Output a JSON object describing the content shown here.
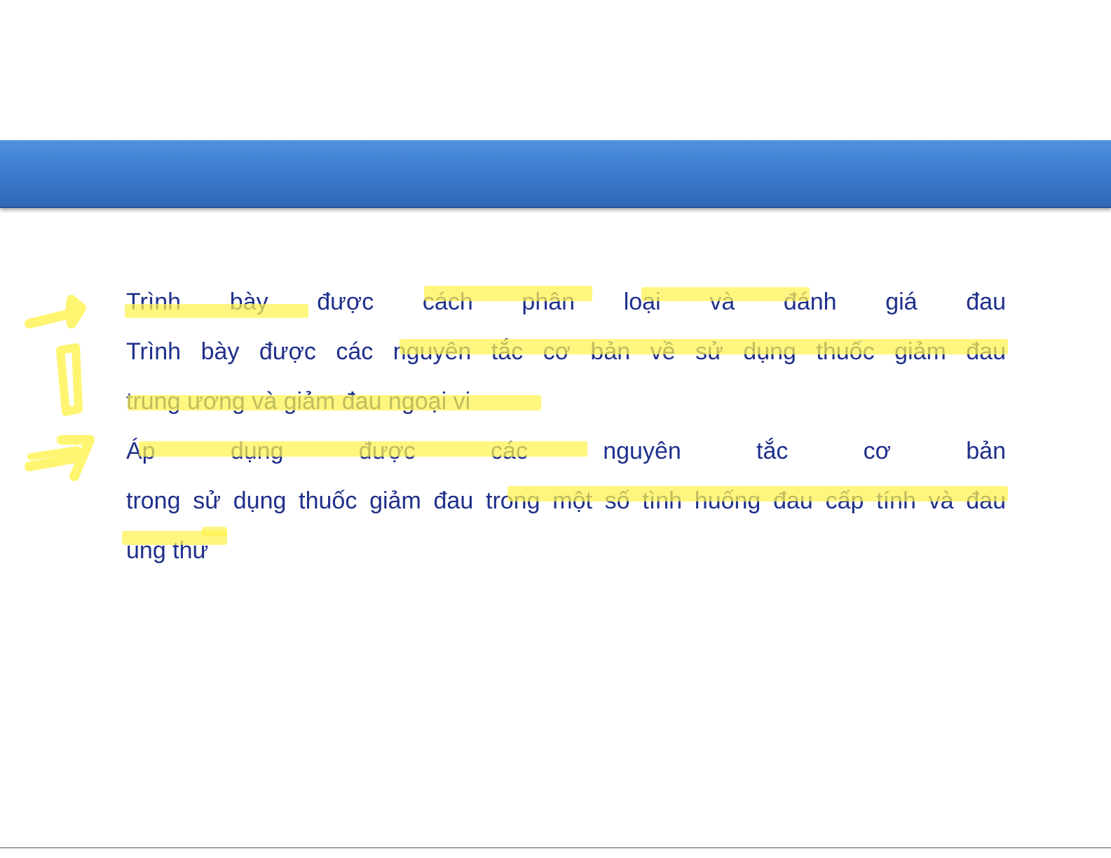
{
  "slide": {
    "title": "",
    "lines": [
      "Trình bày được cách phân loại và đánh giá đau",
      "Trình bày được các nguyên tắc cơ bản về sử dụng thuốc giảm đau",
      "trung ương và giảm đau ngoại vi",
      "Áp dụng được các nguyên tắc cơ bản",
      "trong sử dụng thuốc giảm đau trong một số tình huống đau cấp tính và đau",
      "ung thư"
    ]
  },
  "colors": {
    "title_bar": "#3e7ed0",
    "text": "#1f2f8a",
    "highlighter": "#fff34d"
  }
}
